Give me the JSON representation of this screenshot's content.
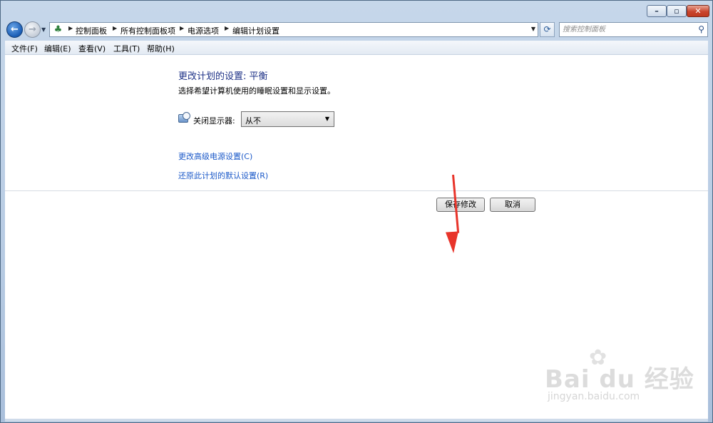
{
  "window": {
    "controls": {
      "minimize": "–",
      "maximize": "▫",
      "close": "✕"
    }
  },
  "navigation": {
    "back_glyph": "←",
    "forward_glyph": "→",
    "breadcrumbs": [
      "控制面板",
      "所有控制面板项",
      "电源选项",
      "编辑计划设置"
    ],
    "refresh_glyph": "⟳",
    "search_placeholder": "搜索控制面板"
  },
  "menu": {
    "items": [
      "文件(F)",
      "编辑(E)",
      "查看(V)",
      "工具(T)",
      "帮助(H)"
    ]
  },
  "content": {
    "title": "更改计划的设置: 平衡",
    "subtitle": "选择希望计算机使用的睡眠设置和显示设置。",
    "display_label": "关闭显示器:",
    "display_value": "从不",
    "links": [
      "更改高级电源设置(C)",
      "还原此计划的默认设置(R)"
    ],
    "save_button": "保存修改",
    "cancel_button": "取消"
  },
  "watermark": {
    "brand": "Bai du 经验",
    "sub": "jingyan.baidu.com"
  },
  "colors": {
    "title": "#1e3287",
    "link": "#1a58c8",
    "annotation_arrow": "#e8342a"
  },
  "icons": [
    "back-icon",
    "forward-icon",
    "control-panel-icon",
    "refresh-icon",
    "search-icon",
    "display-icon",
    "dropdown-arrow-icon"
  ]
}
